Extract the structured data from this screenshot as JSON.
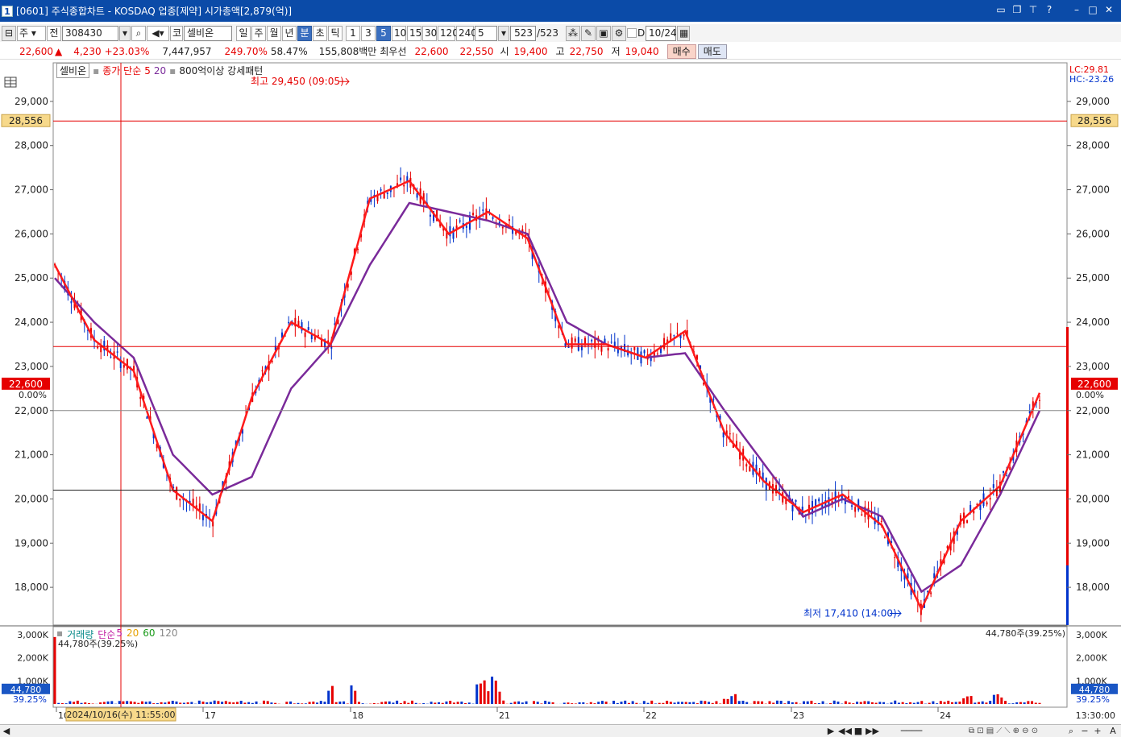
{
  "window": {
    "title": "[0601] 주식종합차트 - KOSDAQ 업종[제약] 시가총액[2,879(억)]",
    "app_icon": "1",
    "controls": [
      "restore-icon",
      "cascade-icon",
      "pin-icon",
      "help-icon",
      "minimize-icon",
      "maximize-icon",
      "close-icon"
    ]
  },
  "toolbar": {
    "period_type": "주",
    "market": "전",
    "code": "308430",
    "code_prefix": "코",
    "name": "셀비온",
    "period_buttons": [
      "일",
      "주",
      "월",
      "년",
      "분",
      "초",
      "틱"
    ],
    "active_period": "분",
    "intervals": [
      "1",
      "3",
      "5",
      "10",
      "15",
      "30",
      "120",
      "240"
    ],
    "active_interval": "5",
    "interval_select": "5",
    "count_value": "523",
    "count_total": "/523",
    "check_label": "D",
    "date_value": "10/24"
  },
  "info": {
    "price": "22,600",
    "up_arrow": "▲",
    "change": "4,230",
    "change_pct": "+23.03%",
    "volume": "7,447,957",
    "vol_ratio": "249.70%",
    "turnover": "58.47%",
    "amount": "155,808백만",
    "best_label": "최우선",
    "best_ask": "22,600",
    "best_bid": "22,550",
    "open_label": "시",
    "open": "19,400",
    "high_label": "고",
    "high": "22,750",
    "low_label": "저",
    "low": "19,040",
    "buy": "매수",
    "sell": "매도"
  },
  "legend": {
    "stock": "셀비온",
    "ma_label": "종가 단순",
    "ma1": "5",
    "ma2": "20",
    "pattern": "800억이상 강세패턴"
  },
  "right_labels": {
    "lc": "LC:29.81",
    "hc": "HC:-23.26"
  },
  "markers": {
    "high": "최고 29,450 (09:05)",
    "low": "최저 17,410 (14:00)",
    "h_line_price": "28,556",
    "current_price": "22,600",
    "pct": "0.00%"
  },
  "volume_legend": {
    "title": "거래량",
    "ma_label": "단순",
    "ma_periods": [
      "5",
      "20",
      "60",
      "120"
    ],
    "current": "44,780주(39.25%)",
    "current_right": "44,780주(39.25%)",
    "box_value": "44,780",
    "box_pct": "39.25%"
  },
  "time_axis": {
    "days": [
      "10",
      "17",
      "18",
      "21",
      "22",
      "23",
      "24"
    ],
    "cursor_label": "2024/10/16(수) 11:55:00",
    "right_time": "13:30:00"
  },
  "price_ticks": [
    "29,000",
    "28,000",
    "27,000",
    "26,000",
    "25,000",
    "24,000",
    "23,000",
    "22,000",
    "21,000",
    "20,000",
    "19,000",
    "18,000"
  ],
  "volume_ticks": [
    "3,000K",
    "2,000K",
    "1,000K"
  ],
  "colors": {
    "title_bar": "#0b4ba8",
    "up": "#e60000",
    "down": "#0033cc",
    "ma5": "#ff1a1a",
    "ma20": "#7a2a9a",
    "price_box": "#f7d98b",
    "current_box": "#e60000"
  },
  "chart_data": {
    "type": "line",
    "title": "",
    "ylim": [
      17200,
      29800
    ],
    "series": [
      {
        "name": "5",
        "x_days": [
          "10",
          "17",
          "18",
          "21",
          "22",
          "23",
          "24"
        ],
        "values": [
          25300,
          23600,
          22900,
          20200,
          19500,
          22300,
          24000,
          23500,
          26800,
          27200,
          26000,
          26500,
          25900,
          23500,
          23500,
          23200,
          23800,
          21500,
          20400,
          19700,
          20100,
          19400,
          17500,
          19500,
          20300,
          22400
        ]
      },
      {
        "name": "20",
        "values": [
          25000,
          24000,
          23200,
          21000,
          20100,
          20500,
          22500,
          23500,
          25300,
          26700,
          26500,
          26300,
          26000,
          24000,
          23500,
          23200,
          23300,
          22000,
          20800,
          19600,
          20000,
          19600,
          17900,
          18500,
          20100,
          22000
        ]
      }
    ]
  }
}
